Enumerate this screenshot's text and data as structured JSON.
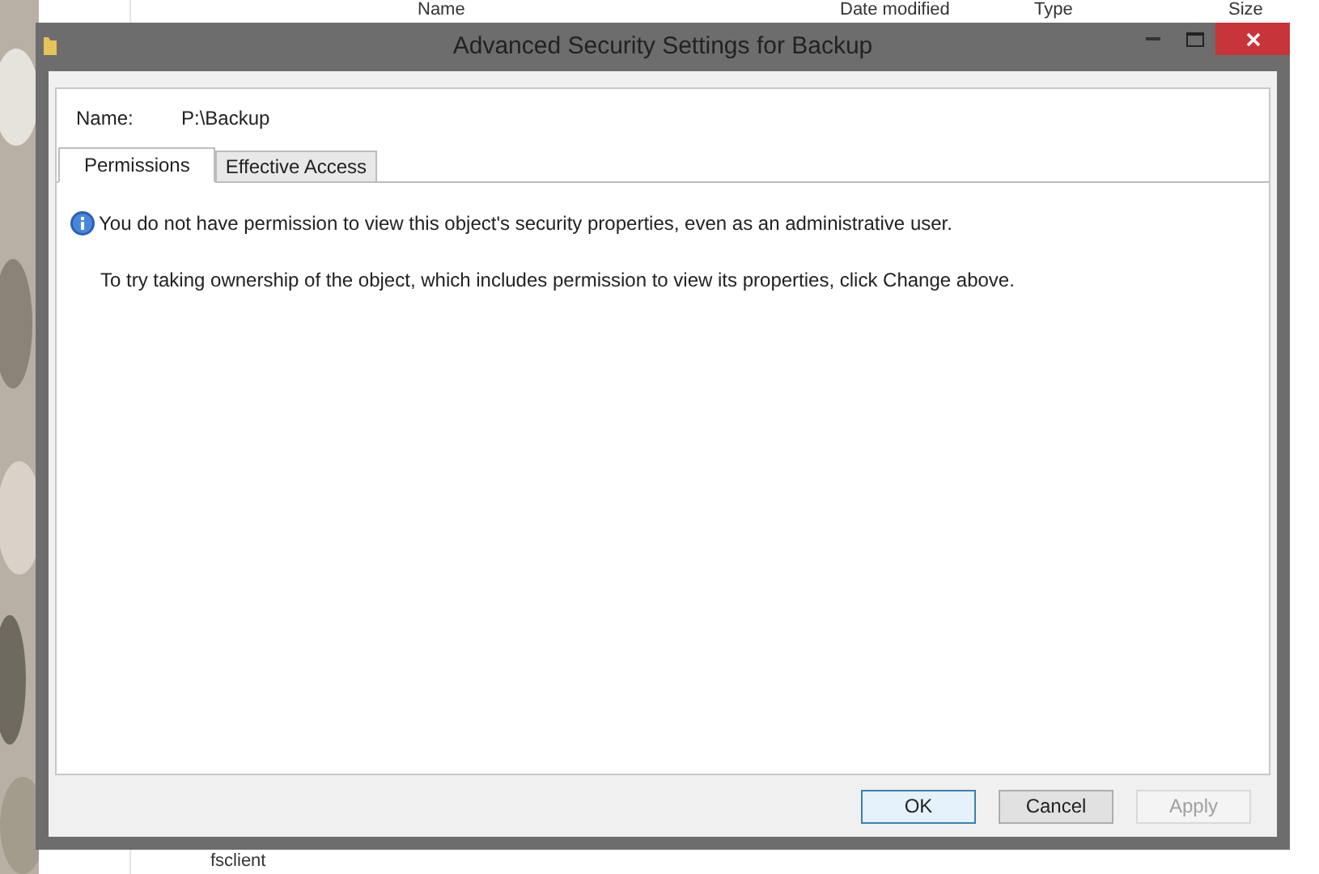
{
  "background_window": {
    "columns": [
      "Name",
      "Date modified",
      "Type",
      "Size"
    ],
    "item": "fsclient"
  },
  "window": {
    "title": "Advanced Security Settings for Backup"
  },
  "name_field": {
    "label": "Name:",
    "value": "P:\\Backup"
  },
  "tabs": [
    {
      "label": "Permissions",
      "selected": true
    },
    {
      "label": "Effective Access",
      "selected": false
    }
  ],
  "message": {
    "info": "You do not have permission to view this object's security properties, even as an administrative user.",
    "hint": "To try taking ownership of the object, which includes permission to view its properties, click Change above."
  },
  "buttons": [
    {
      "label": "OK",
      "default": true,
      "disabled": false
    },
    {
      "label": "Cancel",
      "default": false,
      "disabled": false
    },
    {
      "label": "Apply",
      "default": false,
      "disabled": true
    }
  ]
}
